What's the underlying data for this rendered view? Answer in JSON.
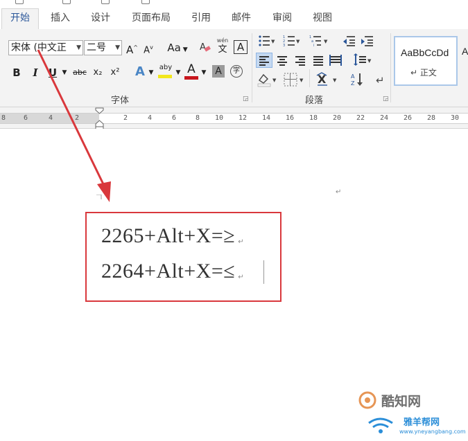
{
  "ribbon": {
    "tabs": [
      {
        "label": "开始",
        "active": true
      },
      {
        "label": "插入",
        "active": false
      },
      {
        "label": "设计",
        "active": false
      },
      {
        "label": "页面布局",
        "active": false
      },
      {
        "label": "引用",
        "active": false
      },
      {
        "label": "邮件",
        "active": false
      },
      {
        "label": "审阅",
        "active": false
      },
      {
        "label": "视图",
        "active": false
      }
    ],
    "font": {
      "font_name": "宋体 (中文正",
      "font_size": "二号",
      "grow": "A",
      "shrink": "A",
      "change_case": "Aa",
      "phonetic_top": "wén",
      "phonetic_bottom": "文",
      "char_border": "A",
      "bold": "B",
      "italic": "I",
      "underline": "U",
      "strikethrough": "abc",
      "subscript": "x₂",
      "superscript": "x²",
      "text_effect": "A",
      "highlight": "aby",
      "font_color": "A",
      "char_shading": "A",
      "enclose": "字",
      "group_label": "字体"
    },
    "paragraph": {
      "group_label": "段落"
    },
    "styles": {
      "style_preview": "AaBbCcDd",
      "style_name": "↵ 正文"
    }
  },
  "ruler": {
    "ticks": [
      "8",
      "6",
      "4",
      "2",
      "2",
      "4",
      "6",
      "8",
      "10",
      "12",
      "14",
      "16",
      "18",
      "20",
      "22",
      "24",
      "26",
      "28",
      "30"
    ]
  },
  "document": {
    "paragraph_mark": "↵",
    "lines": [
      "2265+Alt+X=≥",
      "2264+Alt+X=≤"
    ]
  },
  "watermark": {
    "brand_cn": "酷知网",
    "site_cn": "雅羊帮网",
    "site_url": "www.yneyangbang.com"
  },
  "colors": {
    "accent": "#2b579a",
    "annotation_red": "#d9383c",
    "highlight_yellow": "#f2e71e",
    "font_red": "#c8161d",
    "ribbon_bg": "#f3f3f3"
  }
}
